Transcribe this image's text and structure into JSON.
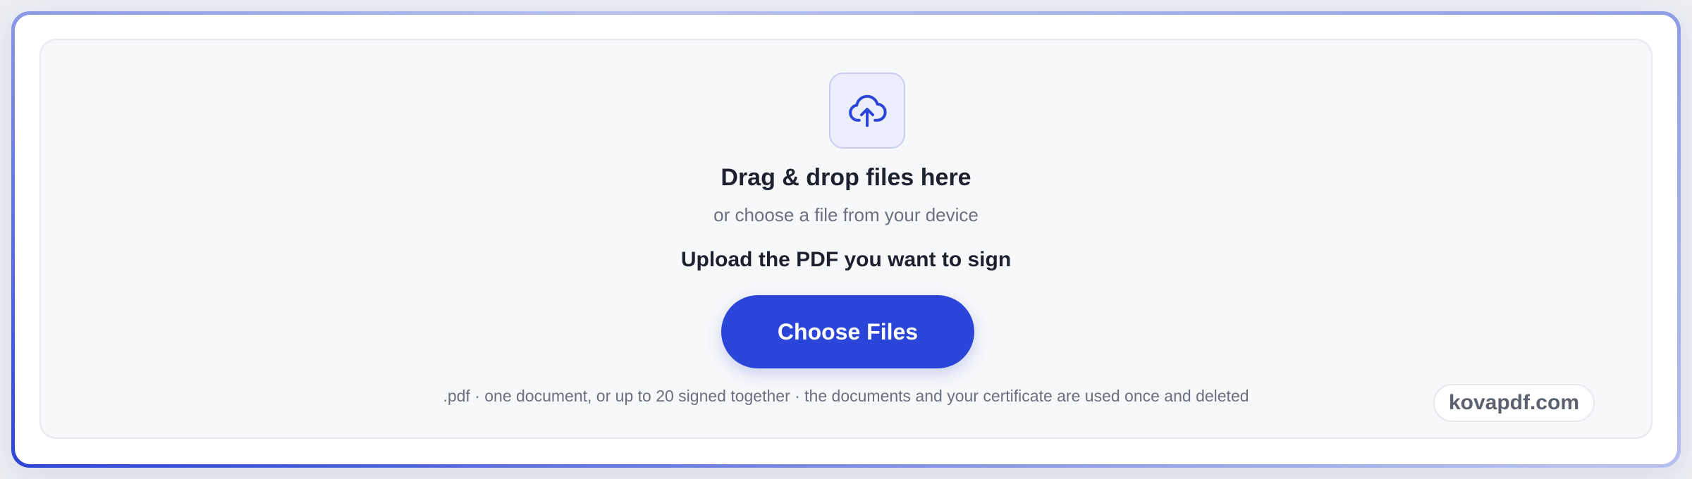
{
  "upload": {
    "icon": "cloud-upload-icon",
    "headline": "Drag & drop files here",
    "subline": "or choose a file from your device",
    "instruction": "Upload the PDF you want to sign",
    "button_label": "Choose Files",
    "footnote": ".pdf · one document, or up to 20 signed together · the documents and your certificate are used once and deleted"
  },
  "brand": {
    "label": "kovapdf.com"
  },
  "colors": {
    "accent": "#2a45d7",
    "icon_bg": "#eceefd",
    "text_dark": "#1c2130",
    "text_muted": "#6b7080"
  }
}
